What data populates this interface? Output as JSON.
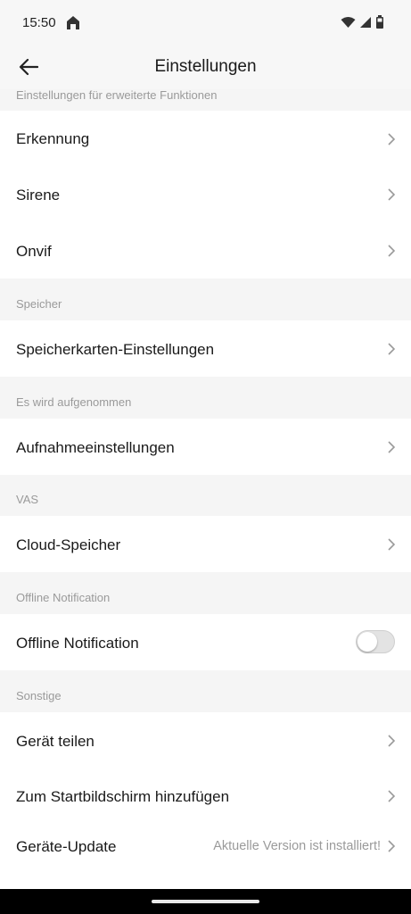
{
  "status": {
    "time": "15:50"
  },
  "header": {
    "title": "Einstellungen",
    "back_icon": "arrow-left-icon"
  },
  "sections": {
    "advanced": "Einstellungen für erweiterte Funktionen",
    "storage": "Speicher",
    "recording": "Es wird aufgenommen",
    "vas": "VAS",
    "offline": "Offline Notification",
    "other": "Sonstige"
  },
  "rows": {
    "detection": "Erkennung",
    "siren": "Sirene",
    "onvif": "Onvif",
    "sdcard": "Speicherkarten-Einstellungen",
    "record_settings": "Aufnahmeeinstellungen",
    "cloud": "Cloud-Speicher",
    "offline_notification": "Offline Notification",
    "share": "Gerät teilen",
    "homescreen": "Zum Startbildschirm hinzufügen",
    "update": "Geräte-Update",
    "update_value": "Aktuelle Version ist installiert!"
  },
  "toggles": {
    "offline_notification": false
  },
  "colors": {
    "background": "#f5f5f5",
    "row": "#ffffff",
    "muted": "#9a9a9a",
    "toggle_off": "#e3e3e3"
  }
}
